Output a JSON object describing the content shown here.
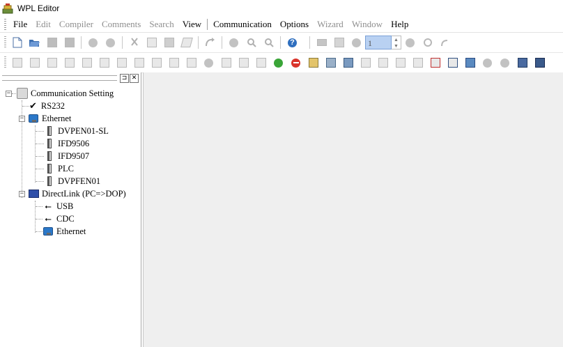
{
  "window": {
    "title": "WPL Editor",
    "app_icon": "wpl-app-icon"
  },
  "menu": {
    "items": [
      {
        "label": "File",
        "enabled": true
      },
      {
        "label": "Edit",
        "enabled": false
      },
      {
        "label": "Compiler",
        "enabled": false
      },
      {
        "label": "Comments",
        "enabled": false
      },
      {
        "label": "Search",
        "enabled": false
      },
      {
        "label": "View",
        "enabled": true
      },
      {
        "label": "Communication",
        "enabled": true
      },
      {
        "label": "Options",
        "enabled": true
      },
      {
        "label": "Wizard",
        "enabled": false
      },
      {
        "label": "Window",
        "enabled": false
      },
      {
        "label": "Help",
        "enabled": true
      }
    ]
  },
  "toolbar1": {
    "station_value": "1",
    "icons": [
      "new-file-icon",
      "open-folder-icon",
      "save-icon",
      "save-all-icon",
      "undo-icon",
      "redo-icon",
      "cut-icon",
      "copy-icon",
      "paste-icon",
      "clear-icon",
      "jump-icon",
      "zoom-icon",
      "zoom-in-icon",
      "zoom-out-icon",
      "help-icon",
      "download-icon",
      "monitor-icon",
      "online-icon",
      "stop-icon",
      "refresh-icon",
      "redirect-icon"
    ]
  },
  "toolbar2": {
    "icons": [
      "compile-icon",
      "table-icon",
      "network-icon",
      "device-icon",
      "chart-icon",
      "screen-icon",
      "grid-icon",
      "list-icon",
      "pen-icon",
      "comment-icon",
      "page-icon",
      "bulb-icon",
      "panel-icon",
      "panel2-icon",
      "panel3-icon",
      "run-icon",
      "stop-red-icon",
      "import-icon",
      "export-icon",
      "satellite-icon",
      "code-icon",
      "code2-icon",
      "code3-icon",
      "align-icon",
      "sort-icon",
      "wrap-icon",
      "image-icon",
      "magnify-icon",
      "ip-icon",
      "lan-icon",
      "connect-icon"
    ]
  },
  "panel": {
    "pin_glyph": "⊐",
    "close_glyph": "✕"
  },
  "tree": {
    "root": "Communication Setting",
    "rs232": "RS232",
    "ethernet": "Ethernet",
    "ethernet_children": [
      "DVPEN01-SL",
      "IFD9506",
      "IFD9507",
      "PLC",
      "DVPFEN01"
    ],
    "directlink": "DirectLink (PC=>DOP)",
    "directlink_children": [
      "USB",
      "CDC",
      "Ethernet"
    ]
  }
}
